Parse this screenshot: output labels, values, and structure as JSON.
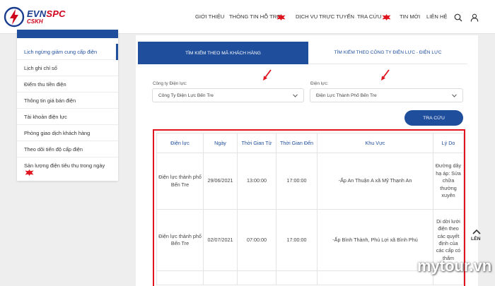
{
  "header": {
    "logo": {
      "main_left": "EVN",
      "main_right": "SPC",
      "sub": "CSKH"
    },
    "nav": [
      {
        "label": "Giới thiệu",
        "new": false
      },
      {
        "label": "Thông tin hỗ trợ",
        "new": true
      },
      {
        "label": "Dịch vụ trực tuyến",
        "new": false
      },
      {
        "label": "Tra cứu",
        "new": true
      },
      {
        "label": "Tin mới",
        "new": false
      },
      {
        "label": "Liên hệ",
        "new": false
      }
    ],
    "icons": {
      "search": "search-icon",
      "user": "user-icon"
    }
  },
  "sidebar": {
    "items": [
      {
        "label": "Lịch ngừng giảm cung cấp điện",
        "active": true
      },
      {
        "label": "Lịch ghi chỉ số",
        "active": false
      },
      {
        "label": "Điểm thu tiền điện",
        "active": false
      },
      {
        "label": "Thông tin giá bán điện",
        "active": false
      },
      {
        "label": "Tài khoản điện lực",
        "active": false
      },
      {
        "label": "Phòng giao dịch khách hàng",
        "active": false
      },
      {
        "label": "Theo dõi tiến độ cấp điện",
        "active": false
      },
      {
        "label": "Sản lượng điện tiêu thụ trong ngày",
        "active": false,
        "new": true
      }
    ]
  },
  "tabs": {
    "customer_code": "Tìm kiếm theo mã khách hàng",
    "company": "Tìm kiếm theo công ty điện lực - điện lực"
  },
  "filters": {
    "company_label": "Công ty Điện lực:",
    "company_value": "Công Ty Điện Lực Bến Tre",
    "unit_label": "Điện lực:",
    "unit_value": "Điện Lực Thành Phố Bến Tre"
  },
  "search_button": "Tra cứu",
  "table": {
    "headers": [
      "Điện lực",
      "Ngày",
      "Thời Gian Từ",
      "Thời Gian Đến",
      "Khu Vực",
      "Lý Do"
    ],
    "rows": [
      [
        "Điện lực thành phố Bến Tre",
        "29/06/2021",
        "13:00:00",
        "17:00:00",
        "-Ấp An Thuận A xã Mỹ Thạnh An",
        "Đường dây hạ áp: Sửa chữa thường xuyên"
      ],
      [
        "Điện lực thành phố Bến Tre",
        "02/07/2021",
        "07:00:00",
        "17:00:00",
        "-Ấp Bình Thành, Phú Lợi xã Bình Phú",
        "Di dời lưới điện theo các quyết định của các cấp có thẩm"
      ]
    ]
  },
  "back_to_top": "LÊN",
  "watermark": "mytour.vn",
  "colors": {
    "primary": "#1f4e9c",
    "highlight": "#e0141e",
    "logo_red": "#d0021b"
  }
}
